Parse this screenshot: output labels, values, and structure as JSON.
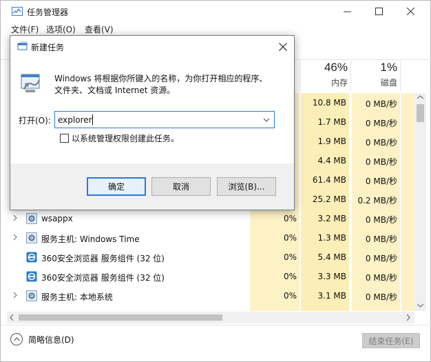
{
  "window": {
    "title": "任务管理器",
    "menu": [
      "文件(F)",
      "选项(O)",
      "查看(V)"
    ]
  },
  "columns": {
    "memory": {
      "percent": "46%",
      "label": "内存"
    },
    "disk": {
      "percent": "1%",
      "label": "磁盘"
    }
  },
  "processes": [
    {
      "name": "",
      "cpu": "",
      "memory": "10.8 MB",
      "disk": "0 MB/秒",
      "expandable": false
    },
    {
      "name": "",
      "cpu": "",
      "memory": "1.7 MB",
      "disk": "0 MB/秒",
      "expandable": false
    },
    {
      "name": "",
      "cpu": "",
      "memory": "1.9 MB",
      "disk": "0 MB/秒",
      "expandable": false
    },
    {
      "name": "",
      "cpu": "",
      "memory": "4.4 MB",
      "disk": "0 MB/秒",
      "expandable": false
    },
    {
      "name": "",
      "cpu": "",
      "memory": "61.4 MB",
      "disk": "0 MB/秒",
      "expandable": false
    },
    {
      "name": "",
      "cpu": "",
      "memory": "25.2 MB",
      "disk": "0.2 MB/秒",
      "expandable": false
    },
    {
      "name": "wsappx",
      "cpu": "0%",
      "memory": "3.2 MB",
      "disk": "0 MB/秒",
      "expandable": true
    },
    {
      "name": "服务主机: Windows Time",
      "cpu": "0%",
      "memory": "1.3 MB",
      "disk": "0 MB/秒",
      "expandable": true
    },
    {
      "name": "360安全浏览器 服务组件 (32 位)",
      "cpu": "0%",
      "memory": "5.4 MB",
      "disk": "0 MB/秒",
      "expandable": false
    },
    {
      "name": "360安全浏览器 服务组件 (32 位)",
      "cpu": "0%",
      "memory": "3.3 MB",
      "disk": "0 MB/秒",
      "expandable": false
    },
    {
      "name": "服务主机: 本地系统",
      "cpu": "0%",
      "memory": "3.1 MB",
      "disk": "0 MB/秒",
      "expandable": true
    }
  ],
  "footer": {
    "details": "简略信息(D)",
    "end_task": "结束任务(E)"
  },
  "run_dialog": {
    "title": "新建任务",
    "description_line1": "Windows 将根据你所键入的名称，为你打开相应的程序、",
    "description_line2": "文件夹、文档或 Internet 资源。",
    "open_label": "打开(O):",
    "open_value": "explorer",
    "admin_label": "以系统管理权限创建此任务。",
    "ok": "确定",
    "cancel": "取消",
    "browse": "浏览(B)..."
  }
}
